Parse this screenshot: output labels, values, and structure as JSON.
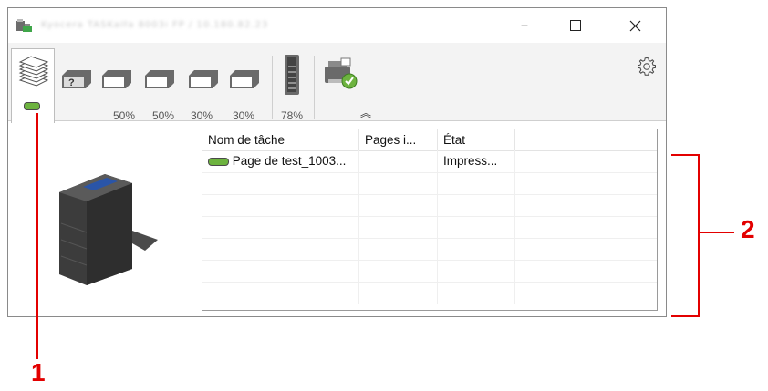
{
  "window": {
    "title": "Kyocera TASKalfa 8003i FP / 10.180.82.23",
    "minimize_glyph": "–",
    "maximize_glyph": "☐",
    "close_glyph": "✕"
  },
  "toolbar": {
    "tabs": [
      {
        "icon": "paper-stack-icon"
      },
      {
        "icon": "tray-unknown-icon",
        "level": ""
      },
      {
        "icon": "tray-icon",
        "level": "50%"
      },
      {
        "icon": "tray-icon",
        "level": "50%"
      },
      {
        "icon": "tray-icon",
        "level": "30%"
      },
      {
        "icon": "tray-icon",
        "level": "30%"
      },
      {
        "icon": "toner-icon",
        "level": "78%"
      },
      {
        "icon": "printer-ok-icon"
      }
    ],
    "collapse_glyph": "︽",
    "settings_icon": "gear-icon"
  },
  "jobs_table": {
    "columns": [
      "Nom de tâche",
      "Pages i...",
      "État"
    ],
    "rows": [
      {
        "name": "Page de test_1003...",
        "pages": "",
        "status": "Impress..."
      }
    ]
  },
  "callouts": {
    "one": "1",
    "two": "2"
  },
  "colors": {
    "callout": "#e30000",
    "status_indicator": "#6db33f"
  }
}
